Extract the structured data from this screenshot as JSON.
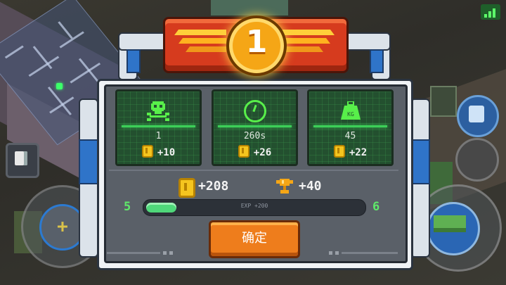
{
  "level_badge": {
    "number": "1"
  },
  "stats": [
    {
      "icon": "skull-icon",
      "value": "1",
      "reward": "+10"
    },
    {
      "icon": "clock-icon",
      "value": "260s",
      "reward": "+26"
    },
    {
      "icon": "weight-icon",
      "value": "45",
      "weight_label": "KG",
      "reward": "+22"
    }
  ],
  "totals": {
    "coins": "+208",
    "trophies": "+40"
  },
  "experience": {
    "current_level": "5",
    "next_level": "6",
    "label": "EXP +200",
    "progress": 0.14
  },
  "confirm_button": {
    "label": "确定"
  },
  "colors": {
    "accent_green": "#58ef4a",
    "coin_gold": "#f5c51f",
    "button_orange": "#ee7d1c",
    "badge_red": "#d63b1e"
  }
}
